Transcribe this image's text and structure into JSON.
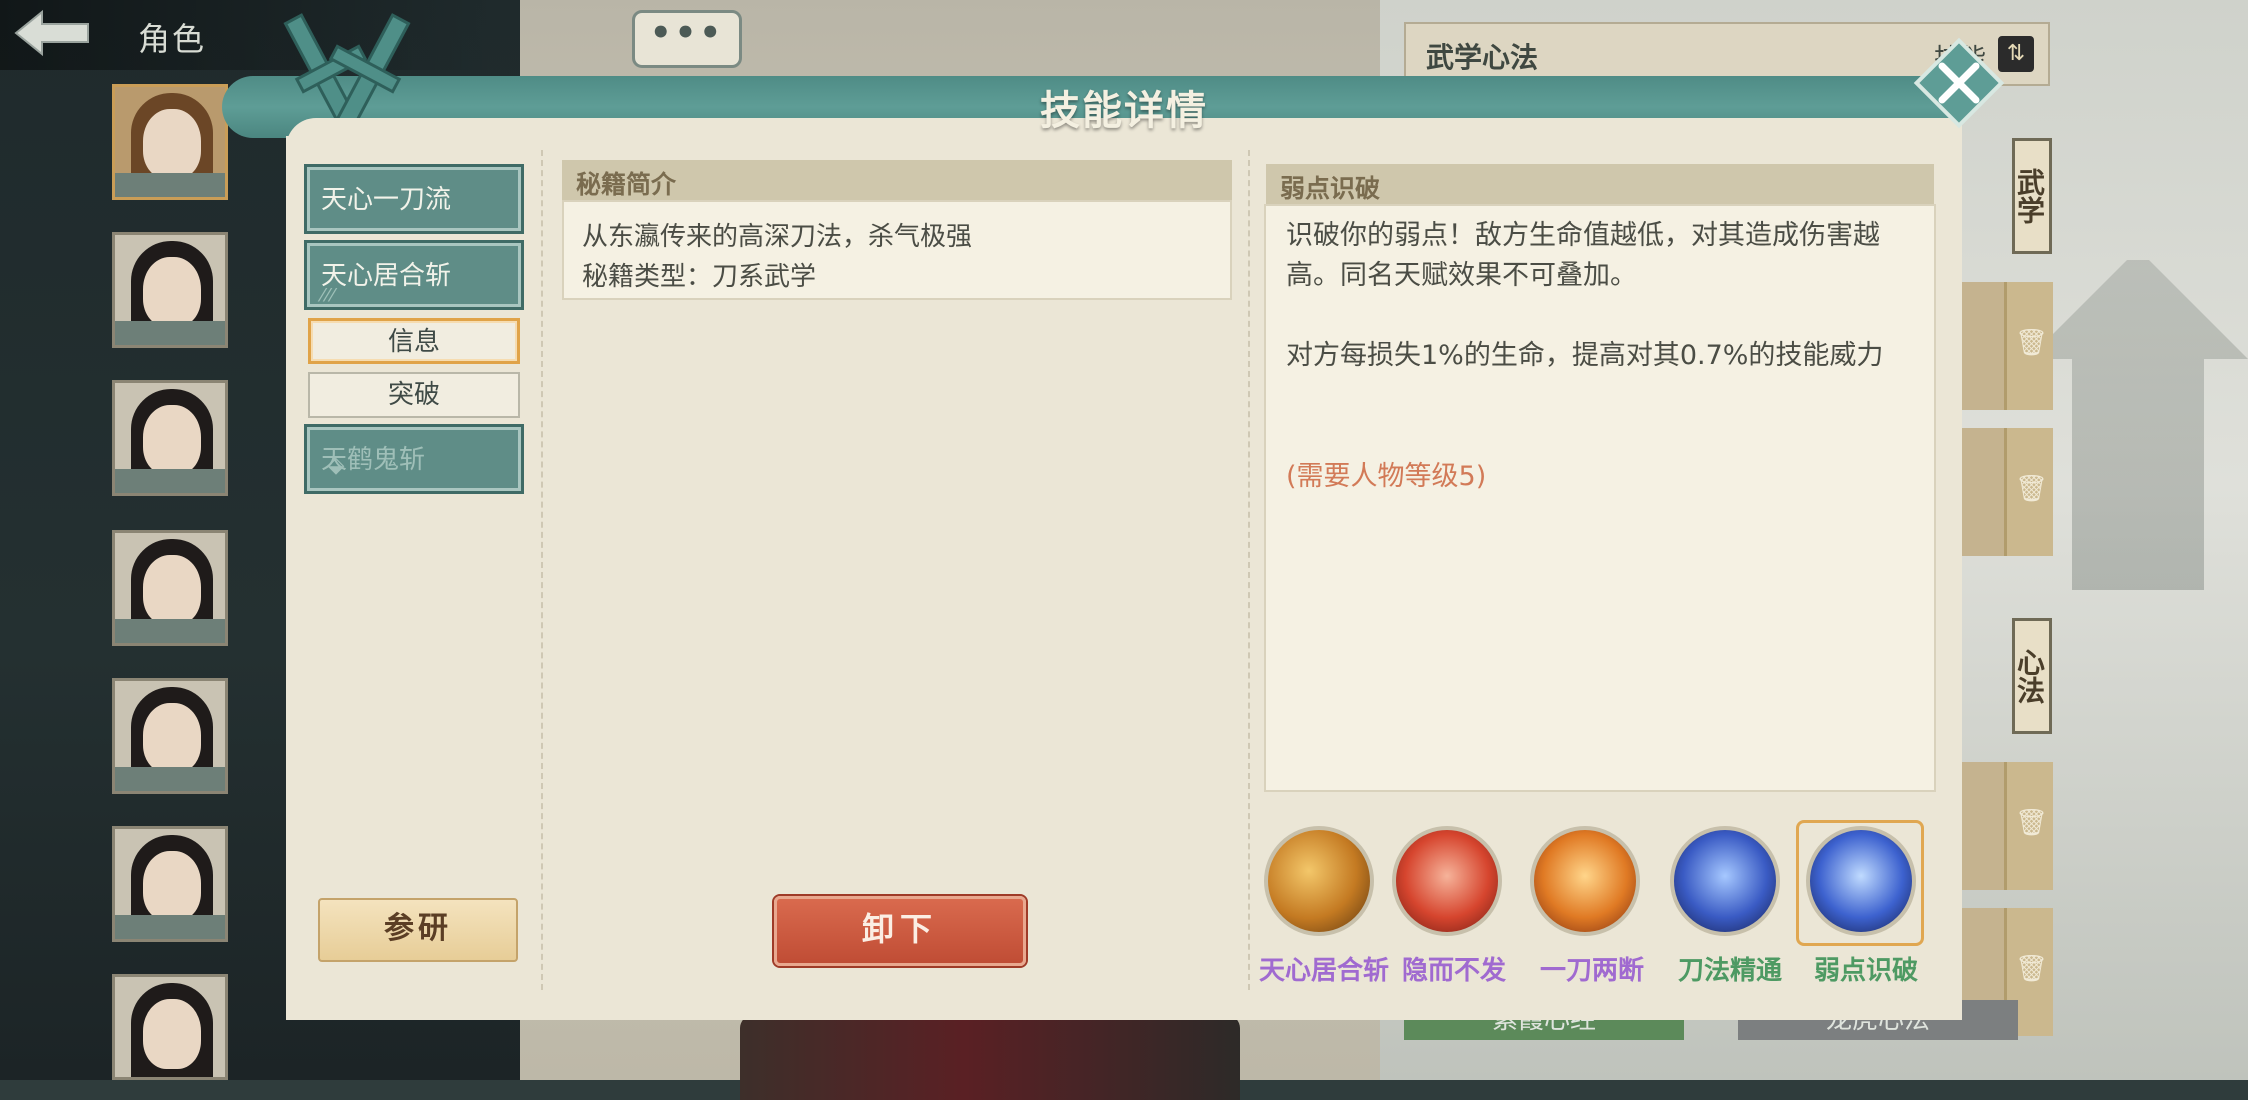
{
  "nav": {
    "title": "角色"
  },
  "chat": {
    "label": "•••"
  },
  "right_panel": {
    "title": "武学心法",
    "sort_label": "技能",
    "tag_martial": "武学",
    "tag_heart": "心法",
    "bottom_chip_1": "紫霞心经",
    "bottom_chip_2": "龙虎心法"
  },
  "modal": {
    "title": "技能详情",
    "skills": [
      {
        "label": "天心一刀流"
      },
      {
        "label": "天心居合斩",
        "sub": "⁄⁄⁄"
      },
      {
        "label": "天鹤鬼斩"
      }
    ],
    "tabs": {
      "info": "信息",
      "breakthrough": "突破"
    },
    "research_button": "参研",
    "unequip_button": "卸下",
    "book": {
      "header": "秘籍简介",
      "description": "从东瀛传来的高深刀法，杀气极强",
      "type_line": "秘籍类型：刀系武学"
    },
    "talent": {
      "header": "弱点识破",
      "text_1": "识破你的弱点！敌方生命值越低，对其造成伤害越高。同名天赋效果不可叠加。",
      "text_2": "对方每损失1%的生命，提高对其0.7%的技能威力",
      "requirement": "(需要人物等级5)"
    },
    "skill_icons": [
      {
        "label": "天心居合斩",
        "color": "#a06ad0"
      },
      {
        "label": "隐而不发",
        "color": "#a06ad0"
      },
      {
        "label": "一刀两断",
        "color": "#a06ad0"
      },
      {
        "label": "刀法精通",
        "color": "#4e9a63"
      },
      {
        "label": "弱点识破",
        "color": "#4e9a63"
      }
    ]
  },
  "colors": {
    "accent": "#5e9d96",
    "button_red": "#c04d35",
    "requirement": "#d27a57"
  }
}
